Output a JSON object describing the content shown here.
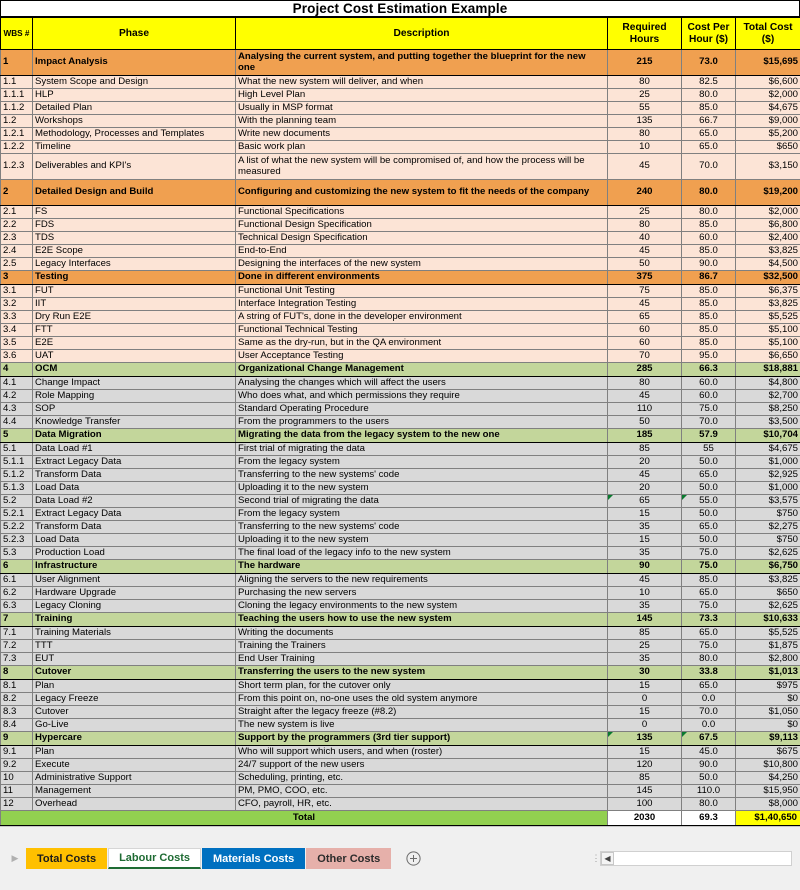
{
  "title": "Project Cost Estimation Example",
  "columns": {
    "wbs": "WBS #",
    "phase": "Phase",
    "description": "Description",
    "hours": "Required Hours",
    "rate": "Cost Per Hour ($)",
    "total": "Total Cost ($)"
  },
  "rows": [
    {
      "wbs": "1",
      "phase": "Impact Analysis",
      "desc": "Analysing the current system, and putting together the blueprint for the new one",
      "hours": "215",
      "rate": "73.0",
      "total": "$15,695",
      "kind": "group",
      "tone": "orange",
      "tall": true
    },
    {
      "wbs": "1.1",
      "phase": "System Scope and Design",
      "desc": "What the new system will deliver, and when",
      "hours": "80",
      "rate": "82.5",
      "total": "$6,600",
      "kind": "detail",
      "tone": "peach"
    },
    {
      "wbs": "1.1.1",
      "phase": "HLP",
      "desc": "High Level Plan",
      "hours": "25",
      "rate": "80.0",
      "total": "$2,000",
      "kind": "detail",
      "tone": "peach"
    },
    {
      "wbs": "1.1.2",
      "phase": "Detailed Plan",
      "desc": "Usually in MSP format",
      "hours": "55",
      "rate": "85.0",
      "total": "$4,675",
      "kind": "detail",
      "tone": "peach"
    },
    {
      "wbs": "1.2",
      "phase": "Workshops",
      "desc": "With the planning team",
      "hours": "135",
      "rate": "66.7",
      "total": "$9,000",
      "kind": "detail",
      "tone": "peach"
    },
    {
      "wbs": "1.2.1",
      "phase": "Methodology, Processes and Templates",
      "desc": "Write new documents",
      "hours": "80",
      "rate": "65.0",
      "total": "$5,200",
      "kind": "detail",
      "tone": "peach"
    },
    {
      "wbs": "1.2.2",
      "phase": "Timeline",
      "desc": "Basic work plan",
      "hours": "10",
      "rate": "65.0",
      "total": "$650",
      "kind": "detail",
      "tone": "peach"
    },
    {
      "wbs": "1.2.3",
      "phase": "Deliverables and KPI's",
      "desc": "A list of what the new system will be compromised of, and how the process will be measured",
      "hours": "45",
      "rate": "70.0",
      "total": "$3,150",
      "kind": "detail",
      "tone": "peach",
      "tall": true
    },
    {
      "wbs": "2",
      "phase": "Detailed Design and Build",
      "desc": "Configuring and customizing the new system to fit the needs of the company",
      "hours": "240",
      "rate": "80.0",
      "total": "$19,200",
      "kind": "group",
      "tone": "orange",
      "tall": true
    },
    {
      "wbs": "2.1",
      "phase": "FS",
      "desc": "Functional Specifications",
      "hours": "25",
      "rate": "80.0",
      "total": "$2,000",
      "kind": "detail",
      "tone": "peach"
    },
    {
      "wbs": "2.2",
      "phase": "FDS",
      "desc": "Functional Design Specification",
      "hours": "80",
      "rate": "85.0",
      "total": "$6,800",
      "kind": "detail",
      "tone": "peach"
    },
    {
      "wbs": "2.3",
      "phase": "TDS",
      "desc": "Technical Design Specification",
      "hours": "40",
      "rate": "60.0",
      "total": "$2,400",
      "kind": "detail",
      "tone": "peach"
    },
    {
      "wbs": "2.4",
      "phase": "E2E Scope",
      "desc": "End-to-End",
      "hours": "45",
      "rate": "85.0",
      "total": "$3,825",
      "kind": "detail",
      "tone": "peach"
    },
    {
      "wbs": "2.5",
      "phase": "Legacy Interfaces",
      "desc": "Designing the interfaces of the new system",
      "hours": "50",
      "rate": "90.0",
      "total": "$4,500",
      "kind": "detail",
      "tone": "peach"
    },
    {
      "wbs": "3",
      "phase": "Testing",
      "desc": "Done in different environments",
      "hours": "375",
      "rate": "86.7",
      "total": "$32,500",
      "kind": "group",
      "tone": "orange"
    },
    {
      "wbs": "3.1",
      "phase": "FUT",
      "desc": "Functional Unit Testing",
      "hours": "75",
      "rate": "85.0",
      "total": "$6,375",
      "kind": "detail",
      "tone": "peach"
    },
    {
      "wbs": "3.2",
      "phase": "IIT",
      "desc": "Interface Integration Testing",
      "hours": "45",
      "rate": "85.0",
      "total": "$3,825",
      "kind": "detail",
      "tone": "peach"
    },
    {
      "wbs": "3.3",
      "phase": "Dry Run E2E",
      "desc": "A string of FUT's, done in the developer environment",
      "hours": "65",
      "rate": "85.0",
      "total": "$5,525",
      "kind": "detail",
      "tone": "peach"
    },
    {
      "wbs": "3.4",
      "phase": "FTT",
      "desc": "Functional Technical Testing",
      "hours": "60",
      "rate": "85.0",
      "total": "$5,100",
      "kind": "detail",
      "tone": "peach"
    },
    {
      "wbs": "3.5",
      "phase": "E2E",
      "desc": "Same as the dry-run, but in the QA environment",
      "hours": "60",
      "rate": "85.0",
      "total": "$5,100",
      "kind": "detail",
      "tone": "peach"
    },
    {
      "wbs": "3.6",
      "phase": "UAT",
      "desc": "User Acceptance Testing",
      "hours": "70",
      "rate": "95.0",
      "total": "$6,650",
      "kind": "detail",
      "tone": "peach"
    },
    {
      "wbs": "4",
      "phase": "OCM",
      "desc": "Organizational Change Management",
      "hours": "285",
      "rate": "66.3",
      "total": "$18,881",
      "kind": "group",
      "tone": "green"
    },
    {
      "wbs": "4.1",
      "phase": "Change Impact",
      "desc": "Analysing the changes which will affect the users",
      "hours": "80",
      "rate": "60.0",
      "total": "$4,800",
      "kind": "detail",
      "tone": "gray"
    },
    {
      "wbs": "4.2",
      "phase": "Role Mapping",
      "desc": "Who does what, and which permissions they require",
      "hours": "45",
      "rate": "60.0",
      "total": "$2,700",
      "kind": "detail",
      "tone": "gray"
    },
    {
      "wbs": "4.3",
      "phase": "SOP",
      "desc": "Standard Operating Procedure",
      "hours": "110",
      "rate": "75.0",
      "total": "$8,250",
      "kind": "detail",
      "tone": "gray"
    },
    {
      "wbs": "4.4",
      "phase": "Knowledge Transfer",
      "desc": "From the programmers to the users",
      "hours": "50",
      "rate": "70.0",
      "total": "$3,500",
      "kind": "detail",
      "tone": "gray"
    },
    {
      "wbs": "5",
      "phase": "Data Migration",
      "desc": "Migrating the data from the legacy system to the new one",
      "hours": "185",
      "rate": "57.9",
      "total": "$10,704",
      "kind": "group",
      "tone": "green"
    },
    {
      "wbs": "5.1",
      "phase": "Data Load #1",
      "desc": "First trial of migrating the data",
      "hours": "85",
      "rate": "55",
      "total": "$4,675",
      "kind": "detail",
      "tone": "gray"
    },
    {
      "wbs": "5.1.1",
      "phase": "Extract Legacy Data",
      "desc": "From the legacy system",
      "hours": "20",
      "rate": "50.0",
      "total": "$1,000",
      "kind": "detail",
      "tone": "gray"
    },
    {
      "wbs": "5.1.2",
      "phase": "Transform Data",
      "desc": "Transferring to the new systems' code",
      "hours": "45",
      "rate": "65.0",
      "total": "$2,925",
      "kind": "detail",
      "tone": "gray"
    },
    {
      "wbs": "5.1.3",
      "phase": "Load Data",
      "desc": "Uploading it to the new system",
      "hours": "20",
      "rate": "50.0",
      "total": "$1,000",
      "kind": "detail",
      "tone": "gray"
    },
    {
      "wbs": "5.2",
      "phase": "Data Load #2",
      "desc": "Second trial of migrating the data",
      "hours": "65",
      "rate": "55.0",
      "total": "$3,575",
      "kind": "detail",
      "tone": "gray",
      "comment": true
    },
    {
      "wbs": "5.2.1",
      "phase": "Extract Legacy Data",
      "desc": "From the legacy system",
      "hours": "15",
      "rate": "50.0",
      "total": "$750",
      "kind": "detail",
      "tone": "gray"
    },
    {
      "wbs": "5.2.2",
      "phase": "Transform Data",
      "desc": "Transferring to the new systems' code",
      "hours": "35",
      "rate": "65.0",
      "total": "$2,275",
      "kind": "detail",
      "tone": "gray"
    },
    {
      "wbs": "5.2.3",
      "phase": "Load Data",
      "desc": "Uploading it to the new system",
      "hours": "15",
      "rate": "50.0",
      "total": "$750",
      "kind": "detail",
      "tone": "gray"
    },
    {
      "wbs": "5.3",
      "phase": "Production Load",
      "desc": "The final load of the legacy info to the new system",
      "hours": "35",
      "rate": "75.0",
      "total": "$2,625",
      "kind": "detail",
      "tone": "gray"
    },
    {
      "wbs": "6",
      "phase": "Infrastructure",
      "desc": "The hardware",
      "hours": "90",
      "rate": "75.0",
      "total": "$6,750",
      "kind": "group",
      "tone": "green"
    },
    {
      "wbs": "6.1",
      "phase": "User Alignment",
      "desc": "Aligning the servers to the new requirements",
      "hours": "45",
      "rate": "85.0",
      "total": "$3,825",
      "kind": "detail",
      "tone": "gray"
    },
    {
      "wbs": "6.2",
      "phase": "Hardware Upgrade",
      "desc": "Purchasing the new servers",
      "hours": "10",
      "rate": "65.0",
      "total": "$650",
      "kind": "detail",
      "tone": "gray"
    },
    {
      "wbs": "6.3",
      "phase": "Legacy Cloning",
      "desc": "Cloning the legacy environments to the new system",
      "hours": "35",
      "rate": "75.0",
      "total": "$2,625",
      "kind": "detail",
      "tone": "gray"
    },
    {
      "wbs": "7",
      "phase": "Training",
      "desc": "Teaching the users how to use the new system",
      "hours": "145",
      "rate": "73.3",
      "total": "$10,633",
      "kind": "group",
      "tone": "green"
    },
    {
      "wbs": "7.1",
      "phase": "Training Materials",
      "desc": "Writing the documents",
      "hours": "85",
      "rate": "65.0",
      "total": "$5,525",
      "kind": "detail",
      "tone": "gray"
    },
    {
      "wbs": "7.2",
      "phase": "TTT",
      "desc": "Training the Trainers",
      "hours": "25",
      "rate": "75.0",
      "total": "$1,875",
      "kind": "detail",
      "tone": "gray"
    },
    {
      "wbs": "7.3",
      "phase": "EUT",
      "desc": "End User Training",
      "hours": "35",
      "rate": "80.0",
      "total": "$2,800",
      "kind": "detail",
      "tone": "gray"
    },
    {
      "wbs": "8",
      "phase": "Cutover",
      "desc": "Transferring the users to the new system",
      "hours": "30",
      "rate": "33.8",
      "total": "$1,013",
      "kind": "group",
      "tone": "green"
    },
    {
      "wbs": "8.1",
      "phase": "Plan",
      "desc": "Short term plan, for the cutover only",
      "hours": "15",
      "rate": "65.0",
      "total": "$975",
      "kind": "detail",
      "tone": "gray"
    },
    {
      "wbs": "8.2",
      "phase": "Legacy Freeze",
      "desc": "From this point on, no-one uses the old system anymore",
      "hours": "0",
      "rate": "0.0",
      "total": "$0",
      "kind": "detail",
      "tone": "gray"
    },
    {
      "wbs": "8.3",
      "phase": "Cutover",
      "desc": "Straight after the legacy freeze (#8.2)",
      "hours": "15",
      "rate": "70.0",
      "total": "$1,050",
      "kind": "detail",
      "tone": "gray"
    },
    {
      "wbs": "8.4",
      "phase": "Go-Live",
      "desc": "The new system is live",
      "hours": "0",
      "rate": "0.0",
      "total": "$0",
      "kind": "detail",
      "tone": "gray"
    },
    {
      "wbs": "9",
      "phase": "Hypercare",
      "desc": "Support by the programmers (3rd tier support)",
      "hours": "135",
      "rate": "67.5",
      "total": "$9,113",
      "kind": "group",
      "tone": "green",
      "comment": true
    },
    {
      "wbs": "9.1",
      "phase": "Plan",
      "desc": "Who will support which users, and when (roster)",
      "hours": "15",
      "rate": "45.0",
      "total": "$675",
      "kind": "detail",
      "tone": "gray"
    },
    {
      "wbs": "9.2",
      "phase": "Execute",
      "desc": "24/7 support of the new users",
      "hours": "120",
      "rate": "90.0",
      "total": "$10,800",
      "kind": "detail",
      "tone": "gray"
    },
    {
      "wbs": "10",
      "phase": "Administrative Support",
      "desc": "Scheduling, printing, etc.",
      "hours": "85",
      "rate": "50.0",
      "total": "$4,250",
      "kind": "detail",
      "tone": "gray"
    },
    {
      "wbs": "11",
      "phase": "Management",
      "desc": "PM, PMO, COO, etc.",
      "hours": "145",
      "rate": "110.0",
      "total": "$15,950",
      "kind": "detail",
      "tone": "gray"
    },
    {
      "wbs": "12",
      "phase": "Overhead",
      "desc": "CFO, payroll, HR, etc.",
      "hours": "100",
      "rate": "80.0",
      "total": "$8,000",
      "kind": "detail",
      "tone": "gray"
    }
  ],
  "total_row": {
    "label": "Total",
    "hours": "2030",
    "rate": "69.3",
    "total": "$1,40,650"
  },
  "tabbar": {
    "nav_prev_icon": "triangle-left-icon",
    "tabs": [
      {
        "label": "Total Costs",
        "style": "t-total",
        "active": false
      },
      {
        "label": "Labour Costs",
        "style": "t-active",
        "active": true
      },
      {
        "label": "Materials Costs",
        "style": "t-materials",
        "active": false
      },
      {
        "label": "Other Costs",
        "style": "t-other",
        "active": false
      }
    ],
    "add_sheet_icon": "plus-circle-icon",
    "scroll_left_icon": "scroll-left-arrow-icon"
  },
  "colors": {
    "header_yellow": "#ffff00",
    "group_orange": "#f0a050",
    "group_green": "#c3d69b",
    "detail_peach": "#fce4d6",
    "detail_gray": "#d9d9d9",
    "total_green": "#92d050",
    "grand_total_yellow": "#ffff00",
    "comment_marker": "#0a7a2f"
  }
}
